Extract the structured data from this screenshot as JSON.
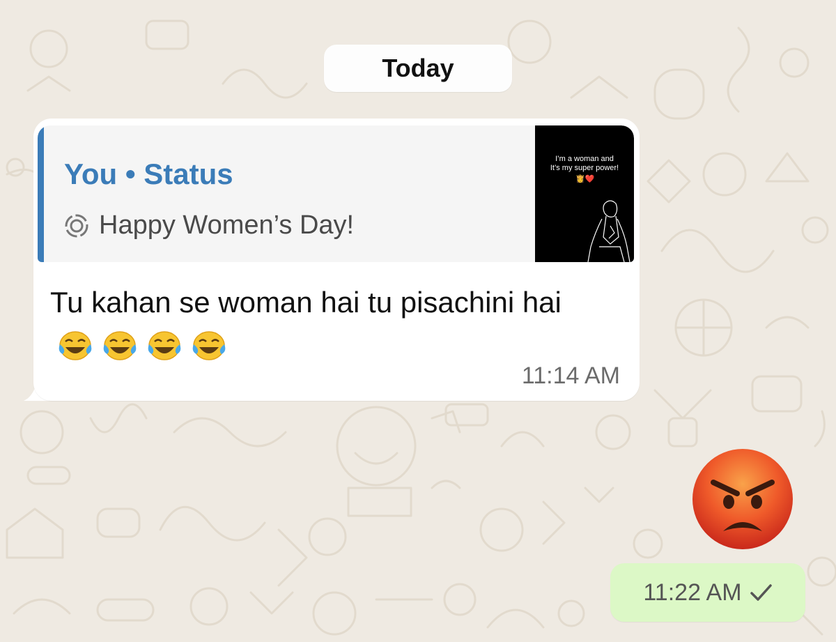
{
  "chat": {
    "date_divider": "Today",
    "incoming": {
      "quote_title": "You • Status",
      "quote_text": "Happy Women’s Day!",
      "thumbnail_text_line1": "I’m a woman and",
      "thumbnail_text_line2": "It’s my super power!",
      "thumbnail_emojis": "👸❤️",
      "text": "Tu kahan se woman hai tu pisachini hai",
      "emojis": "😂😂😂😂",
      "time": "11:14 AM"
    },
    "outgoing": {
      "sticker_icon": "angry-face-emoji",
      "time": "11:22 AM",
      "status_icon": "single-check-icon"
    }
  },
  "colors": {
    "background": "#efeae2",
    "incoming_bubble": "#ffffff",
    "outgoing_bubble": "#dcf8c6",
    "quote_accent": "#3b7cb8"
  }
}
